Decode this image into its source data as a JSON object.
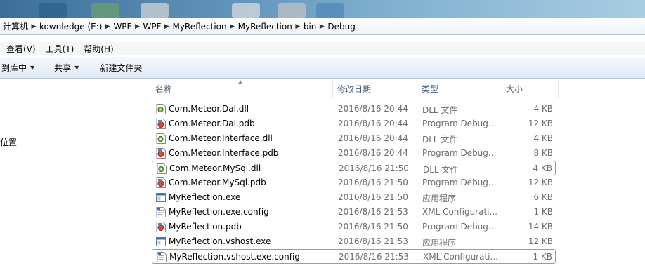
{
  "breadcrumb": [
    {
      "label": "计算机"
    },
    {
      "label": "kownledge (E:)"
    },
    {
      "label": "WPF"
    },
    {
      "label": "WPF"
    },
    {
      "label": "MyReflection"
    },
    {
      "label": "MyReflection"
    },
    {
      "label": "bin"
    },
    {
      "label": "Debug"
    }
  ],
  "menu": [
    {
      "label": "查看(V)"
    },
    {
      "label": "工具(T)"
    },
    {
      "label": "帮助(H)"
    }
  ],
  "toolbar": {
    "include_library": "到库中",
    "share": "共享",
    "new_folder": "新建文件夹"
  },
  "nav": {
    "location_label": "位置"
  },
  "columns": {
    "name": "名称",
    "modified": "修改日期",
    "type": "类型",
    "size": "大小"
  },
  "files": [
    {
      "name": "Com.Meteor.Dal.dll",
      "modified": "2016/8/16 20:44",
      "type": "DLL 文件",
      "size": "4 KB",
      "icon": "dll-file-icon"
    },
    {
      "name": "Com.Meteor.Dal.pdb",
      "modified": "2016/8/16 20:44",
      "type": "Program Debug...",
      "size": "12 KB",
      "icon": "pdb-file-icon"
    },
    {
      "name": "Com.Meteor.Interface.dll",
      "modified": "2016/8/16 20:44",
      "type": "DLL 文件",
      "size": "4 KB",
      "icon": "dll-file-icon"
    },
    {
      "name": "Com.Meteor.Interface.pdb",
      "modified": "2016/8/16 20:44",
      "type": "Program Debug...",
      "size": "8 KB",
      "icon": "pdb-file-icon"
    },
    {
      "name": "Com.Meteor.MySql.dll",
      "modified": "2016/8/16 21:50",
      "type": "DLL 文件",
      "size": "4 KB",
      "icon": "dll-file-icon",
      "selected": true
    },
    {
      "name": "Com.Meteor.MySql.pdb",
      "modified": "2016/8/16 21:50",
      "type": "Program Debug...",
      "size": "12 KB",
      "icon": "pdb-file-icon"
    },
    {
      "name": "MyReflection.exe",
      "modified": "2016/8/16 21:50",
      "type": "应用程序",
      "size": "6 KB",
      "icon": "exe-file-icon"
    },
    {
      "name": "MyReflection.exe.config",
      "modified": "2016/8/16 21:53",
      "type": "XML Configurati...",
      "size": "1 KB",
      "icon": "config-file-icon"
    },
    {
      "name": "MyReflection.pdb",
      "modified": "2016/8/16 21:50",
      "type": "Program Debug...",
      "size": "14 KB",
      "icon": "pdb-file-icon"
    },
    {
      "name": "MyReflection.vshost.exe",
      "modified": "2016/8/16 21:53",
      "type": "应用程序",
      "size": "12 KB",
      "icon": "exe-file-icon"
    },
    {
      "name": "MyReflection.vshost.exe.config",
      "modified": "2016/8/16 21:53",
      "type": "XML Configurati...",
      "size": "1 KB",
      "icon": "config-file-icon",
      "selected": true
    }
  ]
}
